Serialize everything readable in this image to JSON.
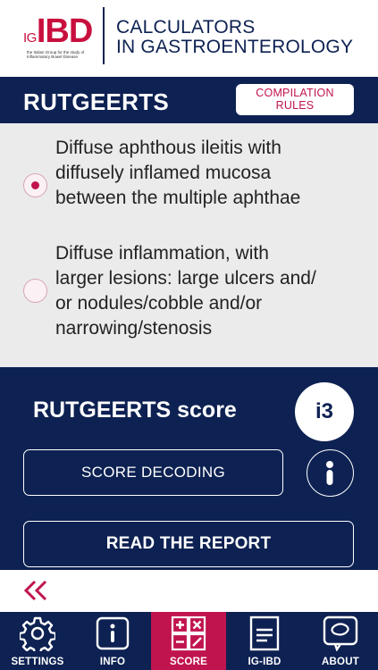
{
  "header": {
    "logo_prefix": "IG",
    "logo_main": "IBD",
    "logo_subtitle": "the Italian Group for the study of\nInflammatory Bowel Disease",
    "title_line1": "CALCULATORS",
    "title_line2": "IN GASTROENTEROLOGY"
  },
  "titlebar": {
    "title": "RUTGEERTS",
    "rules_line1": "COMPILATION",
    "rules_line2": "RULES"
  },
  "options": [
    {
      "text": "Diffuse aphthous ileitis with\ndiffusely inflamed mucosa\nbetween the multiple aphthae",
      "selected": true
    },
    {
      "text": "Diffuse inflammation, with\nlarger lesions: large ulcers and/\nor nodules/cobble and/or\nnarrowing/stenosis",
      "selected": false
    }
  ],
  "score": {
    "label": "RUTGEERTS score",
    "value": "i3",
    "decode_label": "SCORE DECODING",
    "report_label": "READ THE REPORT"
  },
  "tabs": [
    {
      "label": "SETTINGS",
      "icon": "gear-icon",
      "active": false
    },
    {
      "label": "INFO",
      "icon": "info-icon",
      "active": false
    },
    {
      "label": "SCORE",
      "icon": "calculator-icon",
      "active": true
    },
    {
      "label": "IG-IBD",
      "icon": "document-icon",
      "active": false
    },
    {
      "label": "ABOUT",
      "icon": "chat-bubble-icon",
      "active": false
    }
  ],
  "colors": {
    "navy": "#0d2152",
    "accent": "#c0144f",
    "logo_red": "#c8103e",
    "option_bg": "#ebebeb"
  }
}
